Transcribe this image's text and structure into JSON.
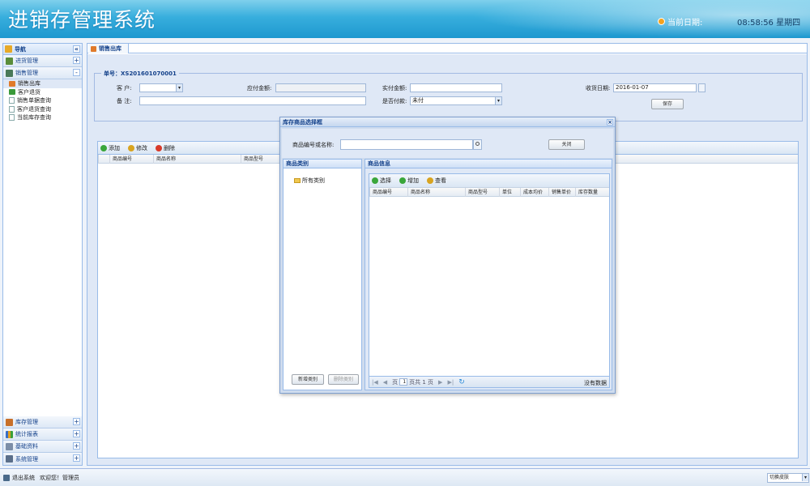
{
  "header": {
    "app_title": "进销存管理系统",
    "date_label": "当前日期:",
    "date_value": "08:58:56 星期四"
  },
  "sidebar": {
    "title": "导航",
    "top_groups": [
      {
        "label": "进货管理",
        "toggle": "+"
      },
      {
        "label": "销售管理",
        "toggle": "-"
      }
    ],
    "tree_items": [
      {
        "label": "销售出库"
      },
      {
        "label": "客户退货"
      },
      {
        "label": "销售单据查询"
      },
      {
        "label": "客户退货查询"
      },
      {
        "label": "当前库存查询"
      }
    ],
    "bottom_groups": [
      {
        "label": "库存管理",
        "toggle": "+"
      },
      {
        "label": "统计报表",
        "toggle": "+"
      },
      {
        "label": "基础资料",
        "toggle": "+"
      },
      {
        "label": "系统管理",
        "toggle": "+"
      }
    ],
    "collapse_symbol": "«"
  },
  "main": {
    "tab_label": "销售出库",
    "order_no": "单号：XS201601070001",
    "form": {
      "customer_label": "客 户:",
      "payable_label": "应付金额:",
      "paid_label": "实付金额:",
      "date_label": "收货日期:",
      "date_value": "2016-01-07",
      "remark_label": "备 注:",
      "is_paid_label": "是否付款:",
      "is_paid_value": "未付",
      "save_label": "保存"
    },
    "toolbar": {
      "add": "添加",
      "edit": "修改",
      "delete": "删除"
    },
    "grid_columns": [
      "商品编号",
      "商品名称",
      "商品型号"
    ]
  },
  "dialog": {
    "title": "库存商品选择框",
    "close_symbol": "×",
    "search_label": "商品编号或名称:",
    "search_value": "",
    "close_button": "关闭",
    "category_header": "商品类别",
    "category_root": "所有类别",
    "add_category": "新增类别",
    "delete_category": "删除类别",
    "goods_header": "商品信息",
    "goods_toolbar": {
      "select": "选择",
      "add": "增加",
      "view": "查看"
    },
    "goods_columns": [
      "商品编号",
      "商品名称",
      "商品型号",
      "单位",
      "成本均价",
      "销售单价",
      "库存数量"
    ],
    "pager": {
      "page_label": "页",
      "page_value": "1",
      "total_text": "页共 1 页",
      "no_data": "没有数据"
    }
  },
  "statusbar": {
    "logout_label": "退出系统",
    "welcome": "欢迎您！管理员",
    "skin_label": "切换皮肤"
  },
  "colors": {
    "header_blue": "#1e98cf",
    "border_blue": "#99bbe8",
    "panel_bg": "#dfe8f6",
    "title_text": "#15428b"
  }
}
